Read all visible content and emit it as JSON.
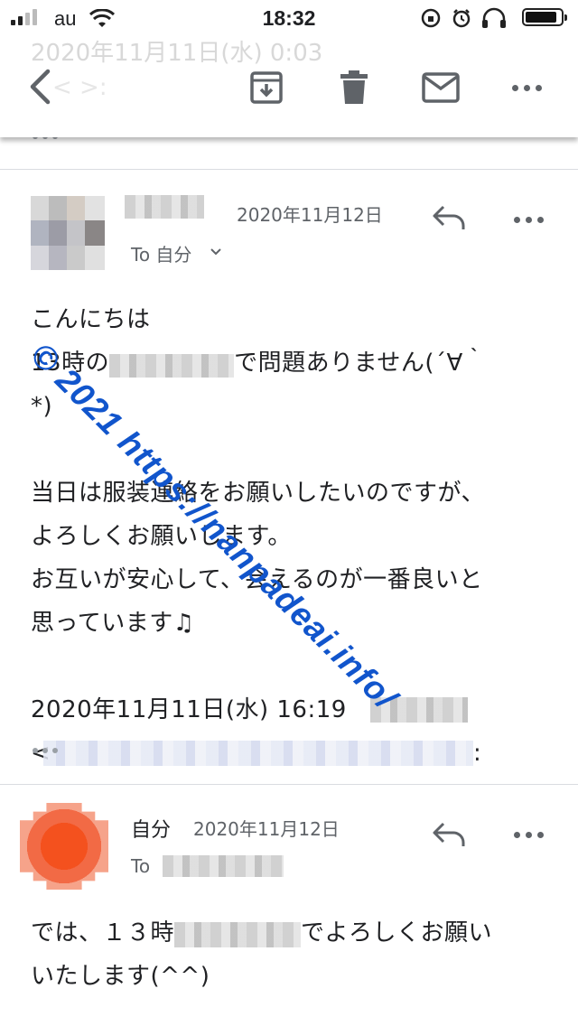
{
  "status_bar": {
    "carrier": "au",
    "time": "18:32"
  },
  "toolbar": {
    "ghost_line": "2020年11月11日(水) 0:03",
    "ghost_line2": "<                      >:",
    "icons": [
      "back-arrow-icon",
      "archive-icon",
      "trash-icon",
      "mail-icon",
      "more-icon"
    ]
  },
  "messages": [
    {
      "date": "2020年11月12日",
      "to_label": "To 自分",
      "body_lines": [
        "こんにちは",
        "13時の",
        "で問題ありません(´∀｀",
        "*)",
        "",
        "当日は服装連絡をお願いしたいのですが、",
        "よろしくお願いします。",
        "お互いが安心して、会えるのが一番良いと",
        "思っています♫",
        "",
        "2020年11月11日(水) 16:19",
        "<",
        ":"
      ]
    },
    {
      "sender": "自分",
      "date": "2020年11月12日",
      "to_label": "To",
      "body_line1_a": "では、１３時",
      "body_line1_b": "でよろしくお願い",
      "body_line2": "いたします(^^)"
    }
  ],
  "watermark": "© 2021  https://nanpadeai.info/",
  "colors": {
    "accent_link": "#1155cc",
    "avatar_self": "#f4511e",
    "text_secondary": "#5f6368"
  }
}
